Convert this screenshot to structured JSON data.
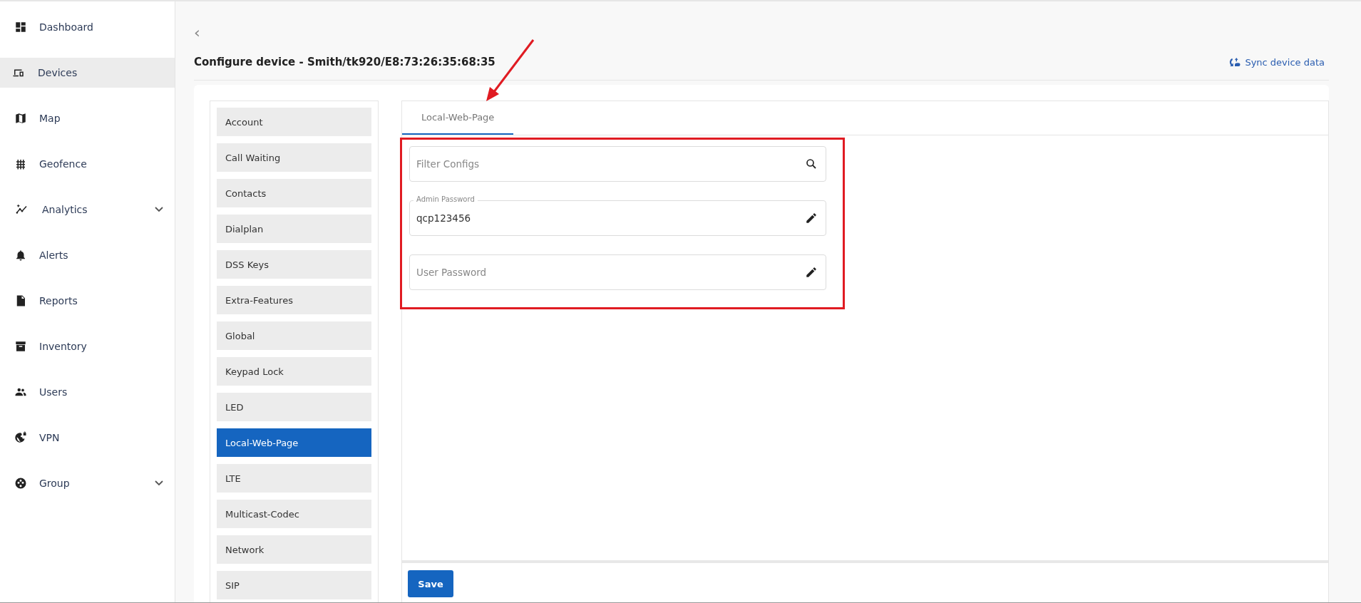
{
  "sidebar": {
    "items": [
      {
        "label": "Dashboard",
        "selected": false,
        "kind": "link"
      },
      {
        "label": "Devices",
        "selected": true,
        "kind": "link"
      },
      {
        "label": "Map",
        "selected": false,
        "kind": "link"
      },
      {
        "label": "Geofence",
        "selected": false,
        "kind": "link"
      },
      {
        "label": "Analytics",
        "selected": false,
        "kind": "group"
      },
      {
        "label": "Alerts",
        "selected": false,
        "kind": "link"
      },
      {
        "label": "Reports",
        "selected": false,
        "kind": "link"
      },
      {
        "label": "Inventory",
        "selected": false,
        "kind": "link"
      },
      {
        "label": "Users",
        "selected": false,
        "kind": "link"
      },
      {
        "label": "VPN",
        "selected": false,
        "kind": "link"
      },
      {
        "label": "Group",
        "selected": false,
        "kind": "group"
      }
    ]
  },
  "header": {
    "back": "‹",
    "title": "Configure device - Smith/tk920/E8:73:26:35:68:35",
    "sync_link": "Sync device data"
  },
  "config_menu": {
    "items": [
      {
        "label": "Account",
        "selected": false
      },
      {
        "label": "Call Waiting",
        "selected": false
      },
      {
        "label": "Contacts",
        "selected": false
      },
      {
        "label": "Dialplan",
        "selected": false
      },
      {
        "label": "DSS Keys",
        "selected": false
      },
      {
        "label": "Extra-Features",
        "selected": false
      },
      {
        "label": "Global",
        "selected": false
      },
      {
        "label": "Keypad Lock",
        "selected": false
      },
      {
        "label": "LED",
        "selected": false
      },
      {
        "label": "Local-Web-Page",
        "selected": true
      },
      {
        "label": "LTE",
        "selected": false
      },
      {
        "label": "Multicast-Codec",
        "selected": false
      },
      {
        "label": "Network",
        "selected": false
      },
      {
        "label": "SIP",
        "selected": false
      }
    ]
  },
  "tabs": [
    {
      "label": "Local-Web-Page",
      "selected": true
    }
  ],
  "fields": [
    {
      "kind": "search",
      "placeholder": "Filter Configs"
    },
    {
      "kind": "edit",
      "label": "Admin Password",
      "value": "qcp123456"
    },
    {
      "kind": "edit",
      "placeholder": "User Password"
    }
  ],
  "buttons": [
    {
      "label": "Save"
    }
  ]
}
